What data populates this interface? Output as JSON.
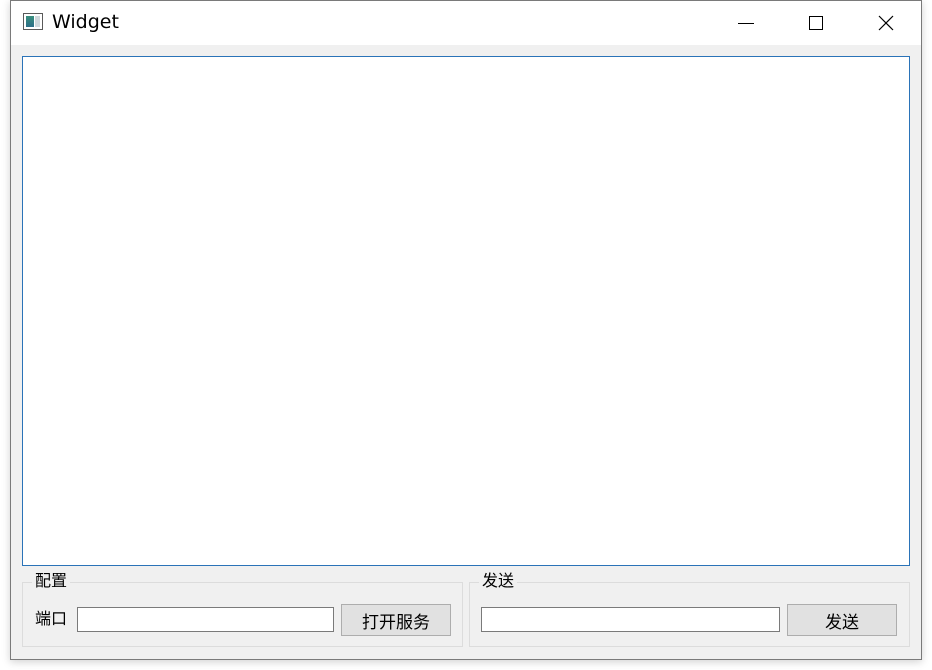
{
  "window": {
    "title": "Widget",
    "icons": {
      "app": "app-window-icon",
      "minimize": "minimize-icon",
      "maximize": "maximize-icon",
      "close": "close-icon"
    }
  },
  "log": {
    "value": ""
  },
  "config": {
    "legend": "配置",
    "port_label": "端口",
    "port_value": "",
    "open_button": "打开服务"
  },
  "send": {
    "legend": "发送",
    "message_value": "",
    "send_button": "发送"
  },
  "colors": {
    "window_bg": "#f0f0f0",
    "titlebar_bg": "#ffffff",
    "focus_border": "#2a73b8",
    "button_bg": "#e1e1e1"
  }
}
